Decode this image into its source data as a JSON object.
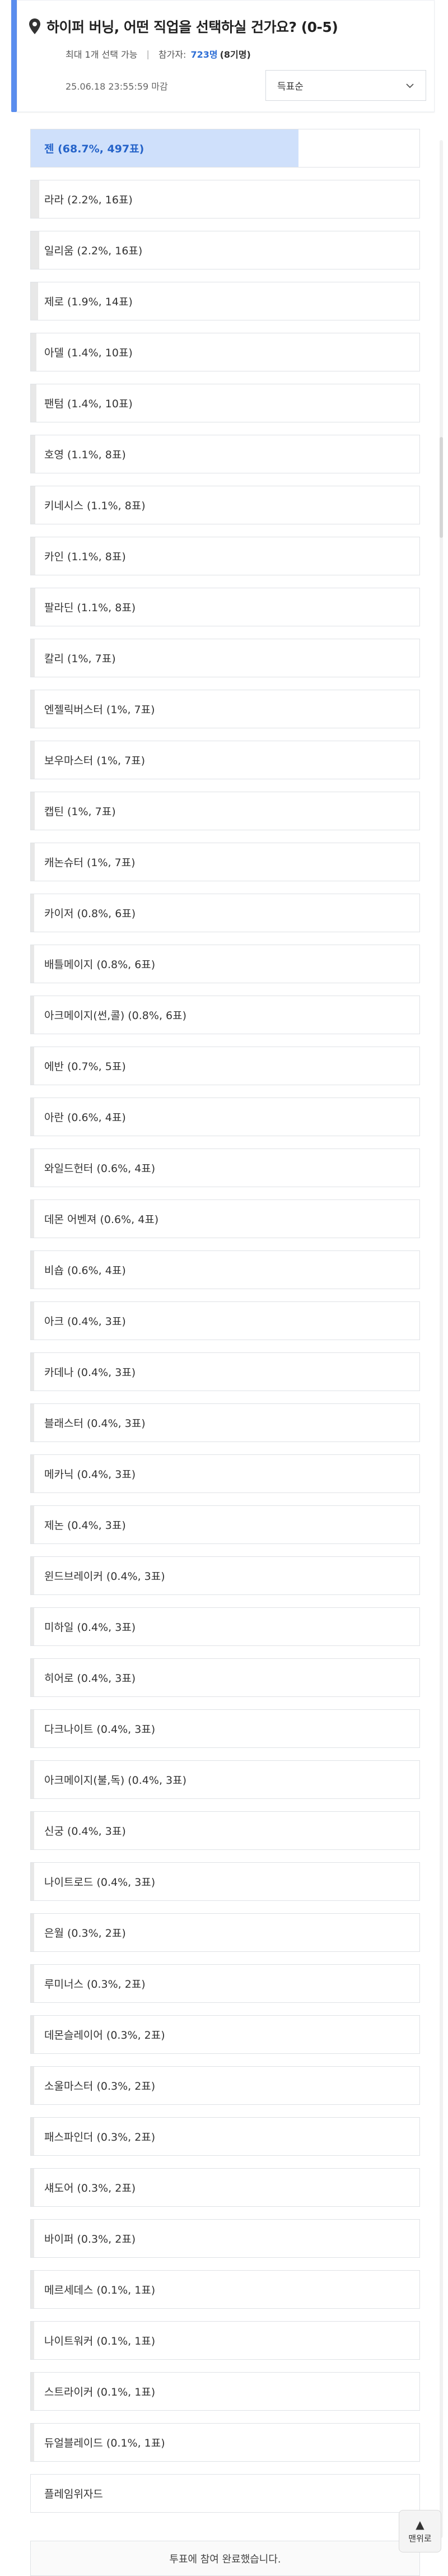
{
  "poll": {
    "title": "하이퍼 버닝, 어떤 직업을 선택하실 건가요? (0-5)",
    "max_selection": "최대 1개 선택 가능",
    "participants_label": "참가자:",
    "participants_count": "723명",
    "pending": "(8기명)",
    "deadline": "25.06.18 23:55:59 마감",
    "sort_label": "득표순"
  },
  "options": [
    {
      "label": "젠 (68.7%, 497표)",
      "pct": 68.7
    },
    {
      "label": "라라 (2.2%, 16표)",
      "pct": 2.2
    },
    {
      "label": "일리움 (2.2%, 16표)",
      "pct": 2.2
    },
    {
      "label": "제로 (1.9%, 14표)",
      "pct": 1.9
    },
    {
      "label": "아델 (1.4%, 10표)",
      "pct": 1.4
    },
    {
      "label": "팬텀 (1.4%, 10표)",
      "pct": 1.4
    },
    {
      "label": "호영 (1.1%, 8표)",
      "pct": 1.1
    },
    {
      "label": "키네시스 (1.1%, 8표)",
      "pct": 1.1
    },
    {
      "label": "카인 (1.1%, 8표)",
      "pct": 1.1
    },
    {
      "label": "팔라딘 (1.1%, 8표)",
      "pct": 1.1
    },
    {
      "label": "칼리 (1%, 7표)",
      "pct": 1.0
    },
    {
      "label": "엔젤릭버스터 (1%, 7표)",
      "pct": 1.0
    },
    {
      "label": "보우마스터 (1%, 7표)",
      "pct": 1.0
    },
    {
      "label": "캡틴 (1%, 7표)",
      "pct": 1.0
    },
    {
      "label": "캐논슈터 (1%, 7표)",
      "pct": 1.0
    },
    {
      "label": "카이저 (0.8%, 6표)",
      "pct": 0.8
    },
    {
      "label": "배틀메이지 (0.8%, 6표)",
      "pct": 0.8
    },
    {
      "label": "아크메이지(썬,콜) (0.8%, 6표)",
      "pct": 0.8
    },
    {
      "label": "에반 (0.7%, 5표)",
      "pct": 0.7
    },
    {
      "label": "아란 (0.6%, 4표)",
      "pct": 0.6
    },
    {
      "label": "와일드헌터 (0.6%, 4표)",
      "pct": 0.6
    },
    {
      "label": "데몬 어벤져 (0.6%, 4표)",
      "pct": 0.6
    },
    {
      "label": "비숍 (0.6%, 4표)",
      "pct": 0.6
    },
    {
      "label": "아크 (0.4%, 3표)",
      "pct": 0.4
    },
    {
      "label": "카데나 (0.4%, 3표)",
      "pct": 0.4
    },
    {
      "label": "블래스터 (0.4%, 3표)",
      "pct": 0.4
    },
    {
      "label": "메카닉 (0.4%, 3표)",
      "pct": 0.4
    },
    {
      "label": "제논 (0.4%, 3표)",
      "pct": 0.4
    },
    {
      "label": "윈드브레이커 (0.4%, 3표)",
      "pct": 0.4
    },
    {
      "label": "미하일 (0.4%, 3표)",
      "pct": 0.4
    },
    {
      "label": "히어로 (0.4%, 3표)",
      "pct": 0.4
    },
    {
      "label": "다크나이트 (0.4%, 3표)",
      "pct": 0.4
    },
    {
      "label": "아크메이지(불,독) (0.4%, 3표)",
      "pct": 0.4
    },
    {
      "label": "신궁 (0.4%, 3표)",
      "pct": 0.4
    },
    {
      "label": "나이트로드 (0.4%, 3표)",
      "pct": 0.4
    },
    {
      "label": "은월 (0.3%, 2표)",
      "pct": 0.3
    },
    {
      "label": "루미너스 (0.3%, 2표)",
      "pct": 0.3
    },
    {
      "label": "데몬슬레이어 (0.3%, 2표)",
      "pct": 0.3
    },
    {
      "label": "소울마스터 (0.3%, 2표)",
      "pct": 0.3
    },
    {
      "label": "패스파인더 (0.3%, 2표)",
      "pct": 0.3
    },
    {
      "label": "섀도어 (0.3%, 2표)",
      "pct": 0.3
    },
    {
      "label": "바이퍼 (0.3%, 2표)",
      "pct": 0.3
    },
    {
      "label": "메르세데스 (0.1%, 1표)",
      "pct": 0.1
    },
    {
      "label": "나이트워커 (0.1%, 1표)",
      "pct": 0.1
    },
    {
      "label": "스트라이커 (0.1%, 1표)",
      "pct": 0.1
    },
    {
      "label": "듀얼블레이드 (0.1%, 1표)",
      "pct": 0.1
    },
    {
      "label": "플레임위자드",
      "pct": 0
    }
  ],
  "footer": {
    "done_text": "투표에 참여 완료했습니다.",
    "top_button": "맨위로"
  },
  "colors": {
    "accent": "#5a8dee",
    "top_option_fill": "#cfe0fb",
    "option_fill": "#e8e8e8",
    "count_text": "#2f6fd6"
  }
}
